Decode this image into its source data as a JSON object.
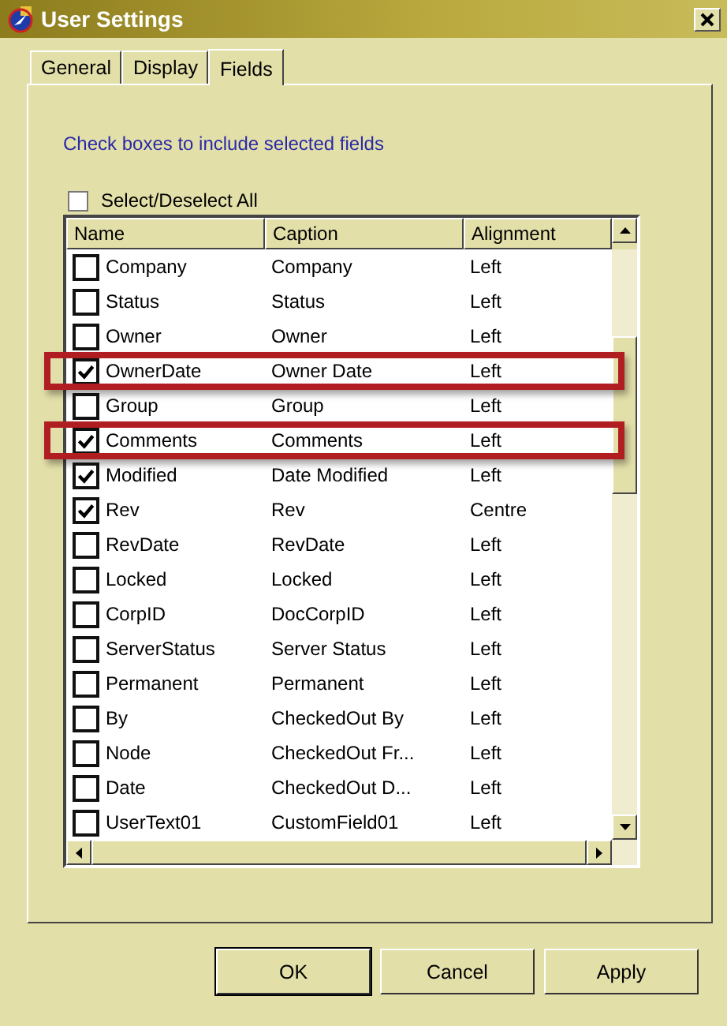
{
  "window": {
    "title": "User Settings"
  },
  "tabs": [
    {
      "label": "General",
      "selected": false
    },
    {
      "label": "Display",
      "selected": false
    },
    {
      "label": "Fields",
      "selected": true
    }
  ],
  "instruction": "Check boxes to include selected fields",
  "select_all": {
    "label": "Select/Deselect All",
    "checked": false
  },
  "table": {
    "columns": [
      "Name",
      "Caption",
      "Alignment"
    ],
    "rows": [
      {
        "name": "Company",
        "caption": "Company",
        "alignment": "Left",
        "checked": false,
        "highlighted": false
      },
      {
        "name": "Status",
        "caption": "Status",
        "alignment": "Left",
        "checked": false,
        "highlighted": false
      },
      {
        "name": "Owner",
        "caption": "Owner",
        "alignment": "Left",
        "checked": false,
        "highlighted": false
      },
      {
        "name": "OwnerDate",
        "caption": "Owner Date",
        "alignment": "Left",
        "checked": true,
        "highlighted": true
      },
      {
        "name": "Group",
        "caption": "Group",
        "alignment": "Left",
        "checked": false,
        "highlighted": false
      },
      {
        "name": "Comments",
        "caption": "Comments",
        "alignment": "Left",
        "checked": true,
        "highlighted": true
      },
      {
        "name": "Modified",
        "caption": "Date Modified",
        "alignment": "Left",
        "checked": true,
        "highlighted": false
      },
      {
        "name": "Rev",
        "caption": "Rev",
        "alignment": "Centre",
        "checked": true,
        "highlighted": false
      },
      {
        "name": "RevDate",
        "caption": "RevDate",
        "alignment": "Left",
        "checked": false,
        "highlighted": false
      },
      {
        "name": "Locked",
        "caption": "Locked",
        "alignment": "Left",
        "checked": false,
        "highlighted": false
      },
      {
        "name": "CorpID",
        "caption": "DocCorpID",
        "alignment": "Left",
        "checked": false,
        "highlighted": false
      },
      {
        "name": "ServerStatus",
        "caption": "Server Status",
        "alignment": "Left",
        "checked": false,
        "highlighted": false
      },
      {
        "name": "Permanent",
        "caption": "Permanent",
        "alignment": "Left",
        "checked": false,
        "highlighted": false
      },
      {
        "name": "By",
        "caption": "CheckedOut By",
        "alignment": "Left",
        "checked": false,
        "highlighted": false
      },
      {
        "name": "Node",
        "caption": "CheckedOut Fr...",
        "alignment": "Left",
        "checked": false,
        "highlighted": false
      },
      {
        "name": "Date",
        "caption": "CheckedOut D...",
        "alignment": "Left",
        "checked": false,
        "highlighted": false
      },
      {
        "name": "UserText01",
        "caption": "CustomField01",
        "alignment": "Left",
        "checked": false,
        "highlighted": false
      }
    ]
  },
  "buttons": [
    "OK",
    "Cancel",
    "Apply"
  ]
}
